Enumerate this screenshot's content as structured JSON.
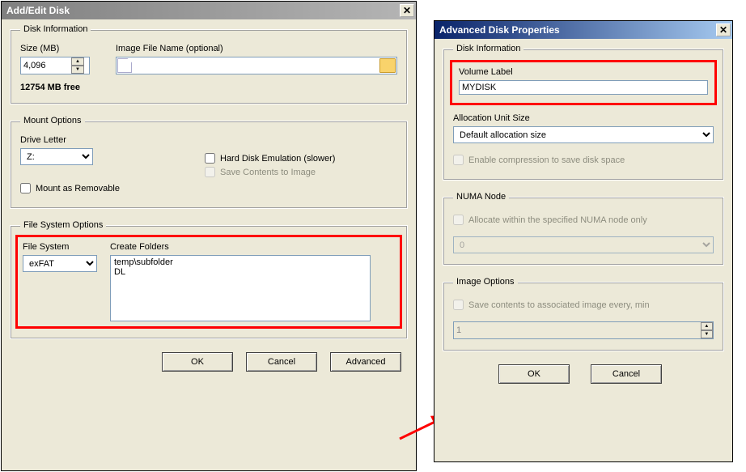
{
  "win1": {
    "title": "Add/Edit Disk",
    "diskInfo": {
      "legend": "Disk Information",
      "sizeLabel": "Size (MB)",
      "sizeValue": "4,096",
      "imageFileLabel": "Image File Name (optional)",
      "imageFileValue": "",
      "freeText": "12754 MB free"
    },
    "mount": {
      "legend": "Mount Options",
      "driveLetterLabel": "Drive Letter",
      "driveLetterValue": "Z:",
      "hardDiskEmu": "Hard Disk Emulation (slower)",
      "saveContents": "Save Contents to Image",
      "mountRemovable": "Mount as Removable"
    },
    "fs": {
      "legend": "File System Options",
      "fsLabel": "File System",
      "fsValue": "exFAT",
      "foldersLabel": "Create Folders",
      "foldersValue": "temp\\subfolder\nDL"
    },
    "buttons": {
      "ok": "OK",
      "cancel": "Cancel",
      "advanced": "Advanced"
    }
  },
  "win2": {
    "title": "Advanced Disk Properties",
    "diskInfo": {
      "legend": "Disk Information",
      "volLabel": "Volume Label",
      "volValue": "MYDISK",
      "allocLabel": "Allocation Unit Size",
      "allocValue": "Default allocation size",
      "compress": "Enable compression to save disk space"
    },
    "numa": {
      "legend": "NUMA Node",
      "alloc": "Allocate within the specified NUMA node only",
      "value": "0"
    },
    "image": {
      "legend": "Image Options",
      "save": "Save contents to associated image every, min",
      "value": "1"
    },
    "buttons": {
      "ok": "OK",
      "cancel": "Cancel"
    }
  }
}
